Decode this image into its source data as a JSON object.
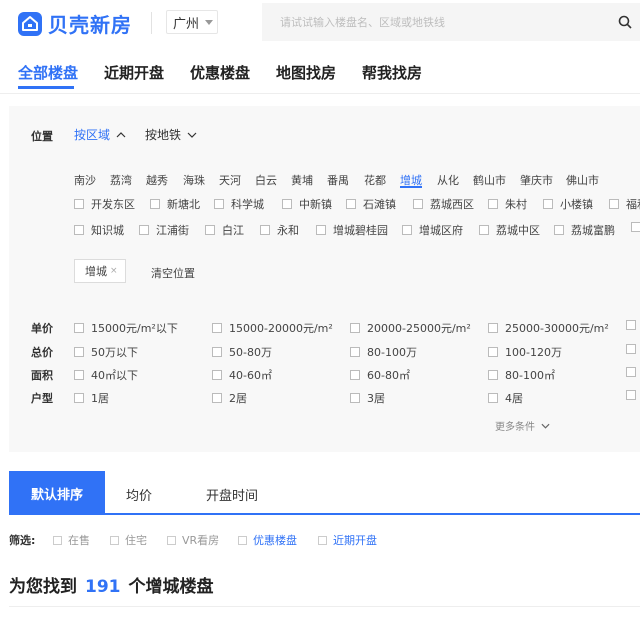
{
  "header": {
    "brand": "贝壳新房",
    "city": "广州",
    "search_placeholder": "请试试输入楼盘名、区域或地铁线"
  },
  "nav": {
    "items": [
      "全部楼盘",
      "近期开盘",
      "优惠楼盘",
      "地图找房",
      "帮我找房"
    ],
    "active": "全部楼盘"
  },
  "filters": {
    "position_label": "位置",
    "tab_region": "按区域",
    "tab_metro": "按地铁",
    "districts": [
      "南沙",
      "荔湾",
      "越秀",
      "海珠",
      "天河",
      "白云",
      "黄埔",
      "番禺",
      "花都",
      "增城",
      "从化",
      "鹤山市",
      "肇庆市",
      "佛山市"
    ],
    "active_district": "增城",
    "subareas_row1": [
      "开发东区",
      "新塘北",
      "科学城",
      "中新镇",
      "石滩镇",
      "荔城西区",
      "朱村",
      "小楼镇",
      "福和"
    ],
    "subareas_row2": [
      "知识城",
      "江浦街",
      "白江",
      "永和",
      "增城碧桂园",
      "增城区府",
      "荔城中区",
      "荔城富鹏",
      ""
    ],
    "selected_chip": "增城",
    "chip_close": "×",
    "clear_label": "清空位置",
    "unit_price": {
      "label": "单价",
      "options": [
        "15000元/m²以下",
        "15000-20000元/m²",
        "20000-25000元/m²",
        "25000-30000元/m²"
      ]
    },
    "total_price": {
      "label": "总价",
      "options": [
        "50万以下",
        "50-80万",
        "80-100万",
        "100-120万"
      ]
    },
    "area": {
      "label": "面积",
      "options": [
        "40㎡以下",
        "40-60㎡",
        "60-80㎡",
        "80-100㎡"
      ]
    },
    "layout": {
      "label": "户型",
      "options": [
        "1居",
        "2居",
        "3居",
        "4居"
      ]
    },
    "more_label": "更多条件"
  },
  "sort": {
    "active": "默认排序",
    "tabs": [
      "均价",
      "开盘时间"
    ]
  },
  "quick_filter": {
    "label": "筛选:",
    "options": [
      "在售",
      "住宅",
      "VR看房",
      "优惠楼盘",
      "近期开盘"
    ]
  },
  "result": {
    "prefix": "为您找到",
    "count": "191",
    "suffix": "个增城楼盘"
  },
  "colors": {
    "accent": "#3072f6",
    "panel_bg": "#f8f8f8"
  }
}
